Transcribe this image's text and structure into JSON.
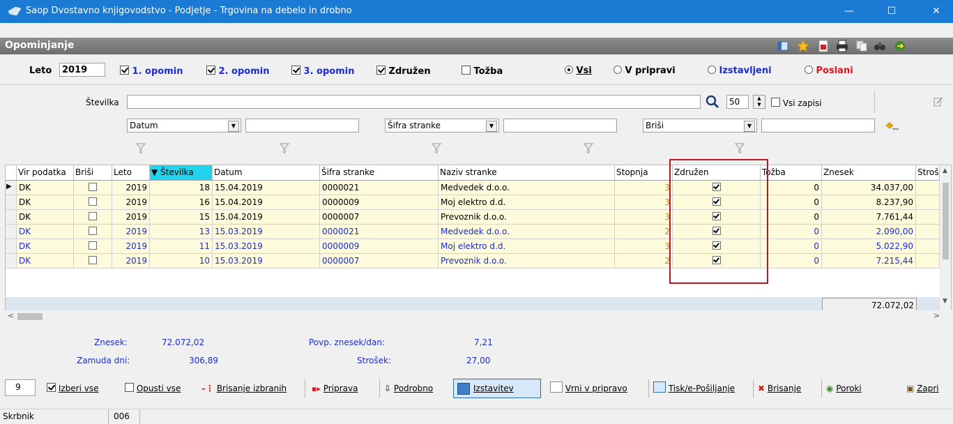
{
  "window": {
    "title": "Saop Dvostavno knjigovodstvo - Podjetje - Trgovina na debelo in drobno",
    "minimize": "—",
    "maximize": "☐",
    "close": "✕"
  },
  "header": {
    "title": "Opominjanje"
  },
  "filters": {
    "year_label": "Leto",
    "year_value": "2019",
    "opomin1": "1. opomin",
    "opomin2": "2. opomin",
    "opomin3": "3. opomin",
    "zdruzen": "Združen",
    "tozba": "Tožba",
    "radio_vsi": "Vsi",
    "radio_vpripravi": "V pripravi",
    "radio_izstavljeni": "Izstavljeni",
    "radio_poslani": "Poslani",
    "izstavljeni_color": "#1a2bd6",
    "poslani_color": "#e0141e"
  },
  "search": {
    "stevilka_label": "Številka",
    "stevilka_value": "",
    "count_value": "50",
    "vsi_zapisi": "Vsi zapisi",
    "combo1": "Datum",
    "combo2": "Šifra stranke",
    "combo3": "Briši"
  },
  "grid": {
    "columns": [
      "Vir podatka",
      "Briši",
      "Leto",
      "Številka",
      "Datum",
      "Šifra stranke",
      "Naziv stranke",
      "Stopnja",
      "Združen",
      "Tožba",
      "Znesek",
      "Stroš"
    ],
    "rows": [
      {
        "vir": "DK",
        "leto": "2019",
        "stevilka": "18",
        "datum": "15.04.2019",
        "sifra": "0000021",
        "naziv": "Medvedek d.o.o.",
        "stopnja": "3",
        "tozba": "0",
        "znesek": "34.037,00",
        "blue": false
      },
      {
        "vir": "DK",
        "leto": "2019",
        "stevilka": "16",
        "datum": "15.04.2019",
        "sifra": "0000009",
        "naziv": "Moj elektro d.d.",
        "stopnja": "3",
        "tozba": "0",
        "znesek": "8.237,90",
        "blue": false
      },
      {
        "vir": "DK",
        "leto": "2019",
        "stevilka": "15",
        "datum": "15.04.2019",
        "sifra": "0000007",
        "naziv": "Prevoznik d.o.o.",
        "stopnja": "3",
        "tozba": "0",
        "znesek": "7.761,44",
        "blue": false
      },
      {
        "vir": "DK",
        "leto": "2019",
        "stevilka": "13",
        "datum": "15.03.2019",
        "sifra": "0000021",
        "naziv": "Medvedek d.o.o.",
        "stopnja": "2",
        "tozba": "0",
        "znesek": "2.090,00",
        "blue": true
      },
      {
        "vir": "DK",
        "leto": "2019",
        "stevilka": "11",
        "datum": "15.03.2019",
        "sifra": "0000009",
        "naziv": "Moj elektro d.d.",
        "stopnja": "3",
        "tozba": "0",
        "znesek": "5.022,90",
        "blue": true
      },
      {
        "vir": "DK",
        "leto": "2019",
        "stevilka": "10",
        "datum": "15.03.2019",
        "sifra": "0000007",
        "naziv": "Prevoznik d.o.o.",
        "stopnja": "2",
        "tozba": "0",
        "znesek": "7.215,44",
        "blue": true
      }
    ],
    "total": "72.072,02"
  },
  "summary": {
    "znesek_label": "Znesek:",
    "znesek_value": "72.072,02",
    "zamuda_label": "Zamuda dni:",
    "zamuda_value": "306,89",
    "povp_label": "Povp. znesek/dan:",
    "povp_value": "7,21",
    "strosek_label": "Strošek:",
    "strosek_value": "27,00"
  },
  "toolbar": {
    "count": "9",
    "izberi_vse": "Izberi vse",
    "opusti_vse": "Opusti vse",
    "brisanje_izbranih": "Brisanje izbranih",
    "priprava": "Priprava",
    "podrobno": "Podrobno",
    "izstavitev": "Izstavitev",
    "vrni": "Vrni v pripravo",
    "tisk": "Tisk/e-Pošiljanje",
    "brisanje": "Brisanje",
    "poroki": "Poroki",
    "zapri": "Zapri"
  },
  "status": {
    "user_label": "Skrbnik",
    "code": "006"
  },
  "colors": {
    "titlebar": "#1a7ad4",
    "row_bg": "#fdfbdc",
    "highlight_box": "#c0141e",
    "sort_header": "#22d3ee"
  }
}
